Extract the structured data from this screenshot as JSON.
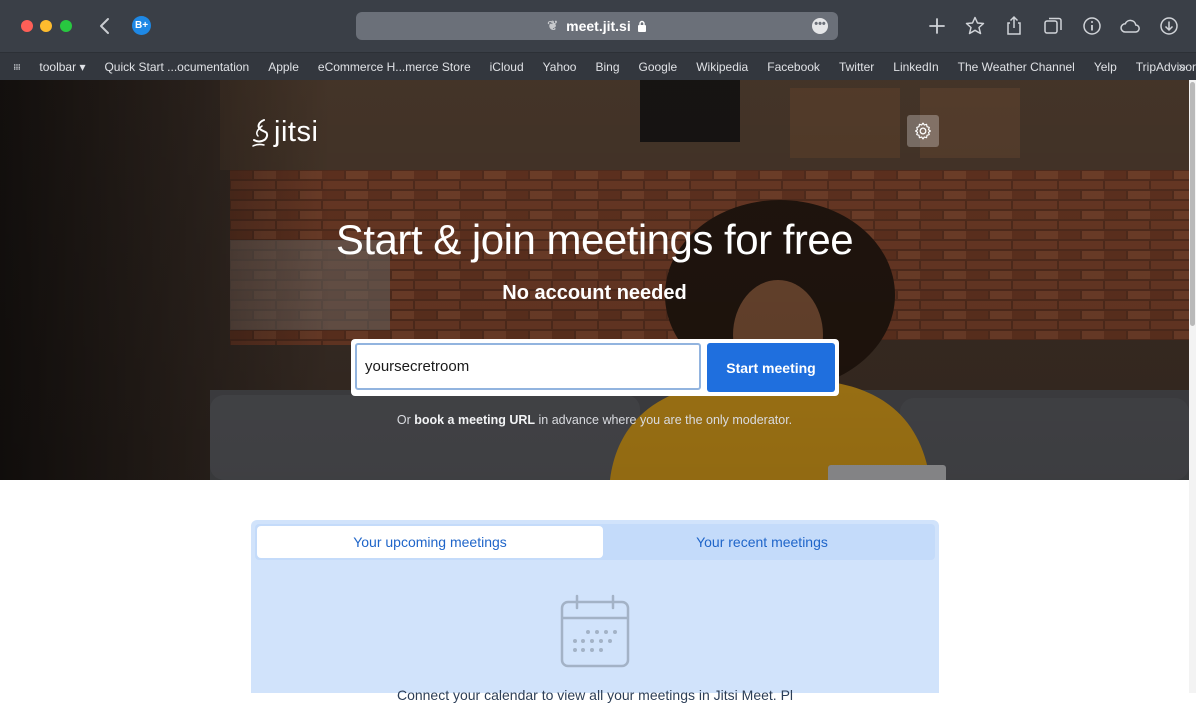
{
  "browser": {
    "url": "meet.jit.si",
    "extension_badge": "B+",
    "toolbar_icons": [
      "new-tab-icon",
      "bookmark-star-icon",
      "share-icon",
      "tabs-overview-icon",
      "info-icon",
      "cloud-icon",
      "downloads-icon"
    ]
  },
  "bookmarks": {
    "items": [
      "toolbar",
      "Quick Start ...ocumentation",
      "Apple",
      "eCommerce H...merce Store",
      "iCloud",
      "Yahoo",
      "Bing",
      "Google",
      "Wikipedia",
      "Facebook",
      "Twitter",
      "LinkedIn",
      "The Weather Channel",
      "Yelp",
      "TripAdvisor"
    ]
  },
  "hero": {
    "logo": "jitsi",
    "title": "Start & join meetings for free",
    "subtitle": "No account needed",
    "room_value": "yoursecretroom",
    "start_button": "Start meeting",
    "note_prefix": "Or ",
    "note_link": "book a meeting URL",
    "note_suffix": " in advance where you are the only moderator."
  },
  "meetings": {
    "tabs": [
      {
        "label": "Your upcoming meetings",
        "selected": true
      },
      {
        "label": "Your recent meetings",
        "selected": false
      }
    ],
    "empty_text": "Connect your calendar to view all your meetings in Jitsi Meet. Pl"
  },
  "colors": {
    "accent": "#1f6fde",
    "panel_bg": "#d1e3fb",
    "tab_text": "#1f65c9"
  }
}
